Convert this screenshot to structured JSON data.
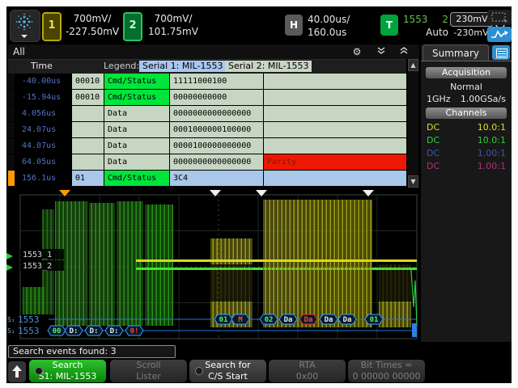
{
  "toolbar": {
    "ch1": {
      "label": "1",
      "scale": "700mV/",
      "offset": "-227.50mV"
    },
    "ch2": {
      "label": "2",
      "scale": "700mV/",
      "offset": "101.75mV"
    },
    "horizontal": {
      "label": "H",
      "scale": "40.00us/",
      "delay": "160.0us"
    },
    "trigger": {
      "label": "T",
      "bus": "1553",
      "source": "2",
      "mode": "Auto",
      "level_high": "230mV",
      "level_low": "-230mV"
    }
  },
  "lister": {
    "title": "All",
    "col_time": "Time",
    "legend_label": "Legend:",
    "serial1": "Serial 1: MIL-1553",
    "serial2": "Serial 2: MIL-1553",
    "rows": [
      {
        "time": "-40.00us",
        "rta": "00010",
        "type": "Cmd/Status",
        "data": "11111000100",
        "error": ""
      },
      {
        "time": "-15.94us",
        "rta": "00010",
        "type": "Cmd/Status",
        "data": "00000000000",
        "error": ""
      },
      {
        "time": "4.056us",
        "rta": "",
        "type": "Data",
        "data": "0000000000000000",
        "error": ""
      },
      {
        "time": "24.07us",
        "rta": "",
        "type": "Data",
        "data": "0001000000100000",
        "error": ""
      },
      {
        "time": "44.07us",
        "rta": "",
        "type": "Data",
        "data": "0000100000000000",
        "error": ""
      },
      {
        "time": "64.05us",
        "rta": "",
        "type": "Data",
        "data": "0000000000000000",
        "error": "Parity"
      },
      {
        "time": "156.1us",
        "rta": "01",
        "type": "Cmd/Status",
        "data": "3C4",
        "error": ""
      }
    ]
  },
  "waveform": {
    "bus1_label": "1553_1",
    "bus2_label": "1553_2",
    "s1_prefix": "S₁",
    "s2_prefix": "S₂",
    "s1_name": "1553",
    "s2_name": "1553",
    "s1_bubbles": [
      {
        "t": "01"
      },
      {
        "t": "M"
      },
      {
        "t": "02"
      },
      {
        "t": "Da"
      },
      {
        "t": "Da"
      },
      {
        "t": "Da"
      },
      {
        "t": "Da"
      },
      {
        "t": "01"
      }
    ],
    "s2_bubbles": [
      {
        "t": "00"
      },
      {
        "t": "D:"
      },
      {
        "t": "D:"
      },
      {
        "t": "D:"
      },
      {
        "t": "0!"
      }
    ]
  },
  "sidebar": {
    "tab": "Summary",
    "acquisition_title": "Acquisition",
    "acq_mode": "Normal",
    "bandwidth": "1GHz",
    "sample_rate": "1.00GSa/s",
    "channels_title": "Channels",
    "channels": [
      {
        "coupling": "DC",
        "probe": "10.0:1"
      },
      {
        "coupling": "DC",
        "probe": "10.0:1"
      },
      {
        "coupling": "DC",
        "probe": "1.00:1"
      },
      {
        "coupling": "DC",
        "probe": "1.00:1"
      }
    ]
  },
  "status": {
    "text": "Search events found: 3"
  },
  "softkeys": {
    "search": {
      "line1": "Search",
      "line2": "S1: MIL-1553"
    },
    "scroll": {
      "line1": "Scroll",
      "line2": "Lister"
    },
    "search_for": {
      "line1": "Search for",
      "line2": "C/S Start"
    },
    "rta": {
      "line1": "RTA",
      "line2": "0x00"
    },
    "bit_times": {
      "line1": "Bit Times =",
      "line2": "0 00000 00000"
    }
  },
  "icons": {
    "gear": "⚙",
    "scroll_up": "▲",
    "scroll_down": "▼"
  },
  "colors": {
    "ch1_yellow": "#dede2a",
    "ch2_green": "#2ecc40",
    "ch3_blue": "#3b57b0",
    "ch4_pink": "#b03079",
    "row_bg": "#c6d6c2",
    "selected_row": "#a9c7e8",
    "cmd_status_green": "#00e53c",
    "error_red": "#ee1800",
    "marker_orange": "#ff9a00",
    "decode_blue": "#3da0ff",
    "softkey_green": "#12a112",
    "accent_blue": "#2e8fd0"
  }
}
